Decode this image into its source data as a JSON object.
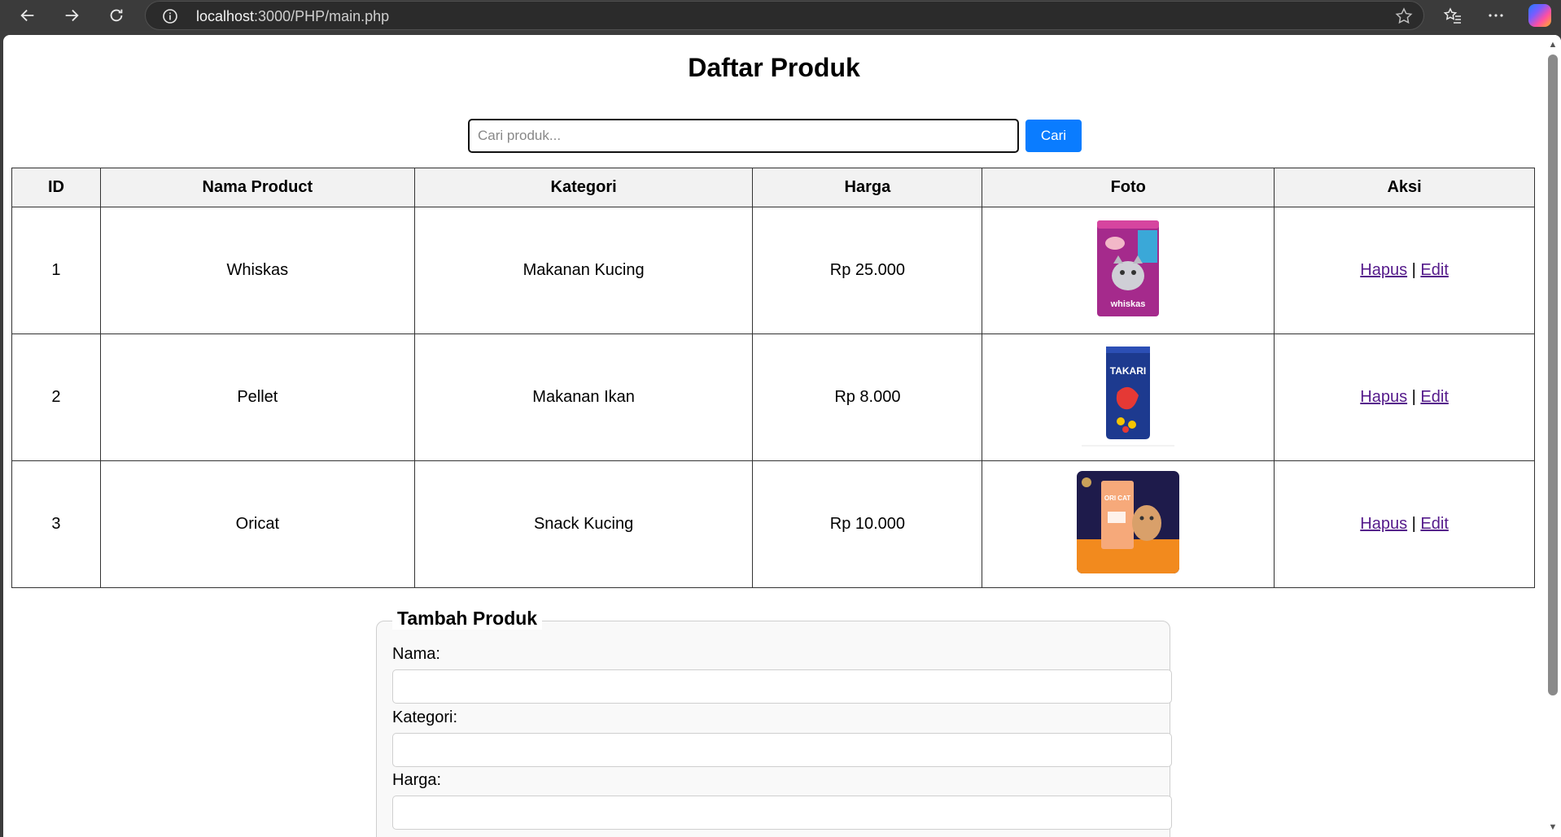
{
  "browser": {
    "url_host": "localhost",
    "url_rest": ":3000/PHP/main.php"
  },
  "page": {
    "title": "Daftar Produk"
  },
  "search": {
    "placeholder": "Cari produk...",
    "value": "",
    "button_label": "Cari"
  },
  "table": {
    "headers": [
      "ID",
      "Nama Product",
      "Kategori",
      "Harga",
      "Foto",
      "Aksi"
    ],
    "rows": [
      {
        "id": "1",
        "name": "Whiskas",
        "category": "Makanan Kucing",
        "price": "Rp 25.000",
        "photo_icon": "whiskas-pack-image",
        "photo_label": "whiskas",
        "delete_label": "Hapus",
        "sep": "|",
        "edit_label": "Edit"
      },
      {
        "id": "2",
        "name": "Pellet",
        "category": "Makanan Ikan",
        "price": "Rp 8.000",
        "photo_icon": "takari-pack-image",
        "photo_label": "TAKARI",
        "delete_label": "Hapus",
        "sep": "|",
        "edit_label": "Edit"
      },
      {
        "id": "3",
        "name": "Oricat",
        "category": "Snack Kucing",
        "price": "Rp 10.000",
        "photo_icon": "oricat-pack-image",
        "photo_label": "ORI CAT",
        "delete_label": "Hapus",
        "sep": "|",
        "edit_label": "Edit"
      }
    ]
  },
  "form": {
    "legend": "Tambah Produk",
    "name_label": "Nama:",
    "category_label": "Kategori:",
    "price_label": "Harga:"
  },
  "colors": {
    "button": "#0a7cff",
    "link": "#551a8b"
  }
}
